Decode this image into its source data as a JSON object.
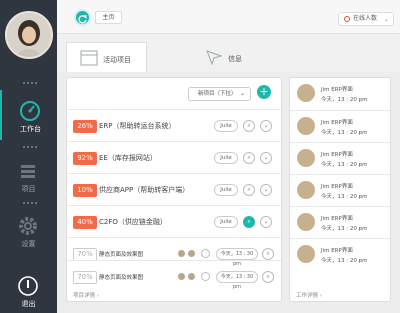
{
  "sidebar": {
    "items": [
      {
        "label": "工作台",
        "icon": "dashboard-icon",
        "active": true
      },
      {
        "label": "项目",
        "icon": "list-icon",
        "active": false
      },
      {
        "label": "设置",
        "icon": "gear-icon",
        "active": false
      },
      {
        "label": "退出",
        "icon": "power-icon",
        "active": false
      }
    ]
  },
  "topbar": {
    "home_tab": "主页",
    "online_label": "在线人数",
    "online_chevron": "⌄"
  },
  "tabs": [
    {
      "label": "活动项目",
      "icon": "browser-window-icon",
      "active": true
    },
    {
      "label": "信息",
      "icon": "send-arrow-icon",
      "active": false
    }
  ],
  "main": {
    "new_project_label": "新项目（下拉）",
    "new_project_chevron": "⌄",
    "plus_label": "+",
    "rows": [
      {
        "pct": "26%",
        "title": "ERP（帮助转运台系统）",
        "assignee": "Julie"
      },
      {
        "pct": "92%",
        "title": "EE（库存报网站）",
        "assignee": "Julie"
      },
      {
        "pct": "10%",
        "title": "供应商APP（帮助转客户端）",
        "assignee": "Julie"
      },
      {
        "pct": "40%",
        "title": "C2FO（供应链金融）",
        "assignee": "Julie"
      }
    ],
    "completed_rows": [
      {
        "pct": "70%",
        "title": "静态页面及效果图",
        "time": "今天，13 : 30 pm"
      },
      {
        "pct": "70%",
        "title": "静态页面及效果图",
        "time": "今天，13 : 30 pm"
      }
    ],
    "search_glyph": "⌕",
    "chevron_glyph": "⌄",
    "footer": "项目详情 ›"
  },
  "side": {
    "items": [
      {
        "name": "Jim   ERP界面",
        "time": "今天，13 : 20 pm"
      },
      {
        "name": "Jim   ERP界面",
        "time": "今天，13 : 20 pm"
      },
      {
        "name": "Jim   ERP界面",
        "time": "今天，13 : 20 pm"
      },
      {
        "name": "Jim   ERP界面",
        "time": "今天，13 : 20 pm"
      },
      {
        "name": "Jim   ERP界面",
        "time": "今天，13 : 20 pm"
      },
      {
        "name": "Jim   ERP界面",
        "time": "今天，13 : 20 pm"
      }
    ],
    "footer": "工作详情 ›"
  },
  "colors": {
    "accent": "#1fb7ad",
    "hot": "#f36b46",
    "sidebar_bg": "#2f3640"
  }
}
